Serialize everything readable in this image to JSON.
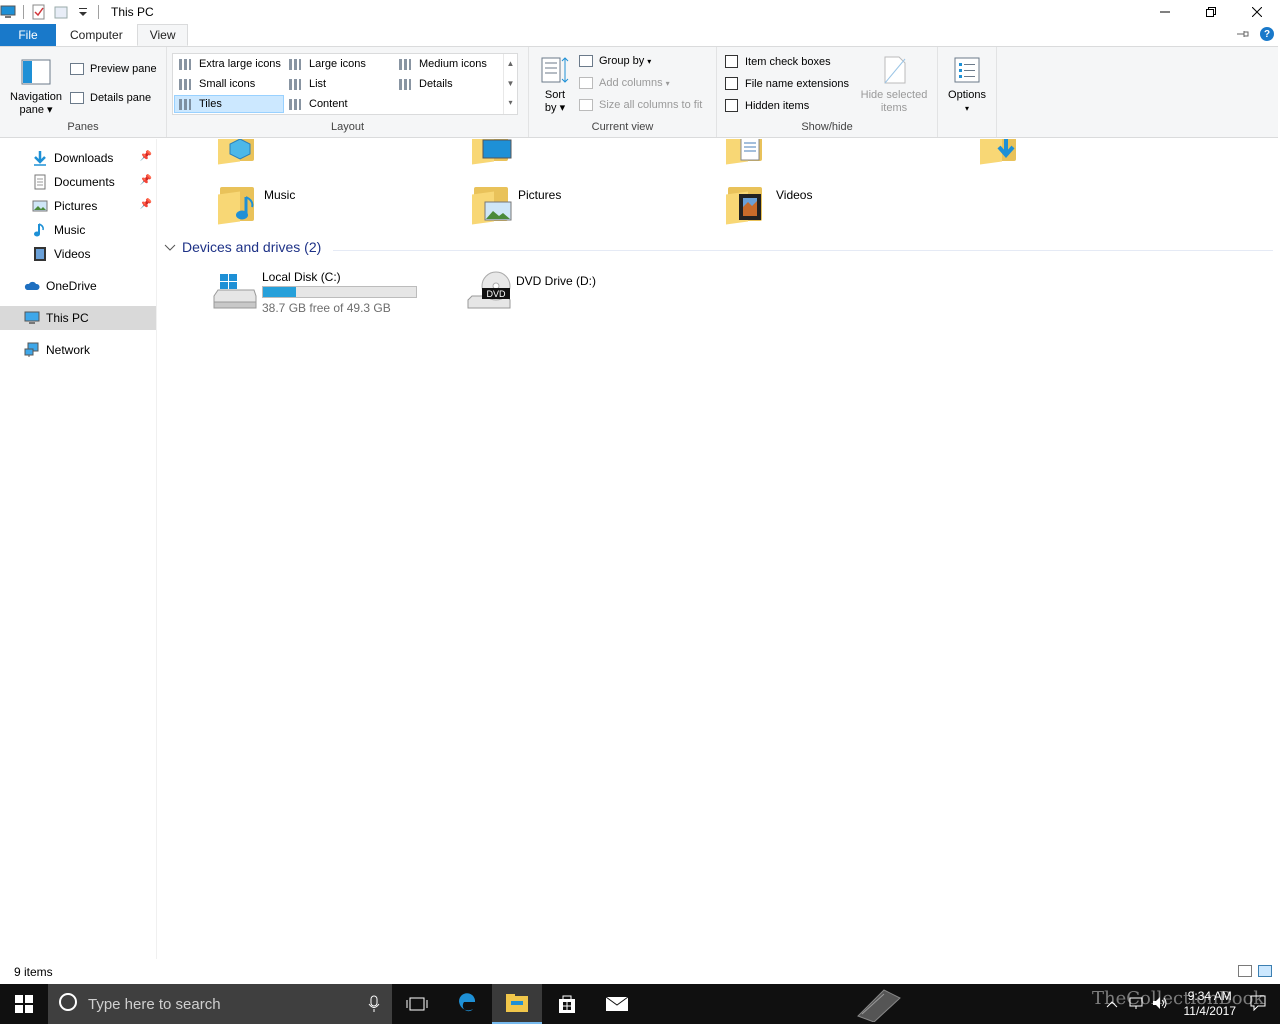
{
  "window": {
    "title": "This PC",
    "minimize_glyph": "—",
    "maximize_glyph": "❐",
    "close_glyph": "✕"
  },
  "ribbon_tabs": [
    {
      "label": "File"
    },
    {
      "label": "Computer"
    },
    {
      "label": "View"
    }
  ],
  "ribbon": {
    "panes": {
      "group_label": "Panes",
      "navigation_pane_line1": "Navigation",
      "navigation_pane_line2": "pane",
      "preview_pane": "Preview pane",
      "details_pane": "Details pane"
    },
    "layout": {
      "group_label": "Layout",
      "options": [
        "Extra large icons",
        "Large icons",
        "Medium icons",
        "Small icons",
        "List",
        "Details",
        "Tiles",
        "Content"
      ],
      "selected": "Tiles"
    },
    "current_view": {
      "group_label": "Current view",
      "sort_by_line1": "Sort",
      "sort_by_line2": "by",
      "group_by": "Group by",
      "add_columns": "Add columns",
      "size_all_columns": "Size all columns to fit"
    },
    "show_hide": {
      "group_label": "Show/hide",
      "item_check_boxes": "Item check boxes",
      "file_name_extensions": "File name extensions",
      "hidden_items": "Hidden items",
      "hide_selected_line1": "Hide selected",
      "hide_selected_line2": "items"
    },
    "options": {
      "label": "Options"
    }
  },
  "nav_pane": {
    "items": [
      {
        "label": "Downloads",
        "icon": "download-arrow-icon",
        "pinned": true
      },
      {
        "label": "Documents",
        "icon": "document-icon",
        "pinned": true
      },
      {
        "label": "Pictures",
        "icon": "pictures-icon",
        "pinned": true
      },
      {
        "label": "Music",
        "icon": "music-note-icon",
        "pinned": false
      },
      {
        "label": "Videos",
        "icon": "video-icon",
        "pinned": false
      },
      {
        "label": "OneDrive",
        "icon": "cloud-icon",
        "pinned": false
      },
      {
        "label": "This PC",
        "icon": "computer-icon",
        "pinned": false,
        "selected": true
      },
      {
        "label": "Network",
        "icon": "network-icon",
        "pinned": false
      }
    ]
  },
  "folders": [
    {
      "label": "Music"
    },
    {
      "label": "Pictures"
    },
    {
      "label": "Videos"
    }
  ],
  "devices_section": {
    "header": "Devices and drives (2)"
  },
  "drives": [
    {
      "name": "Local Disk (C:)",
      "free_text": "38.7 GB free of 49.3 GB",
      "used_fraction": 0.215
    },
    {
      "name": "DVD Drive (D:)",
      "badge": "DVD"
    }
  ],
  "status": {
    "item_count": "9 items"
  },
  "taskbar": {
    "search_placeholder": "Type here to search",
    "time": "9:34 AM",
    "date": "11/4/2017",
    "watermark": "TheCollectionBook"
  },
  "colors": {
    "accent": "#1979ca",
    "selection": "#cce8ff",
    "usage_bar": "#26a0da",
    "folder": "#f8d775",
    "section_header": "#1e3287"
  }
}
